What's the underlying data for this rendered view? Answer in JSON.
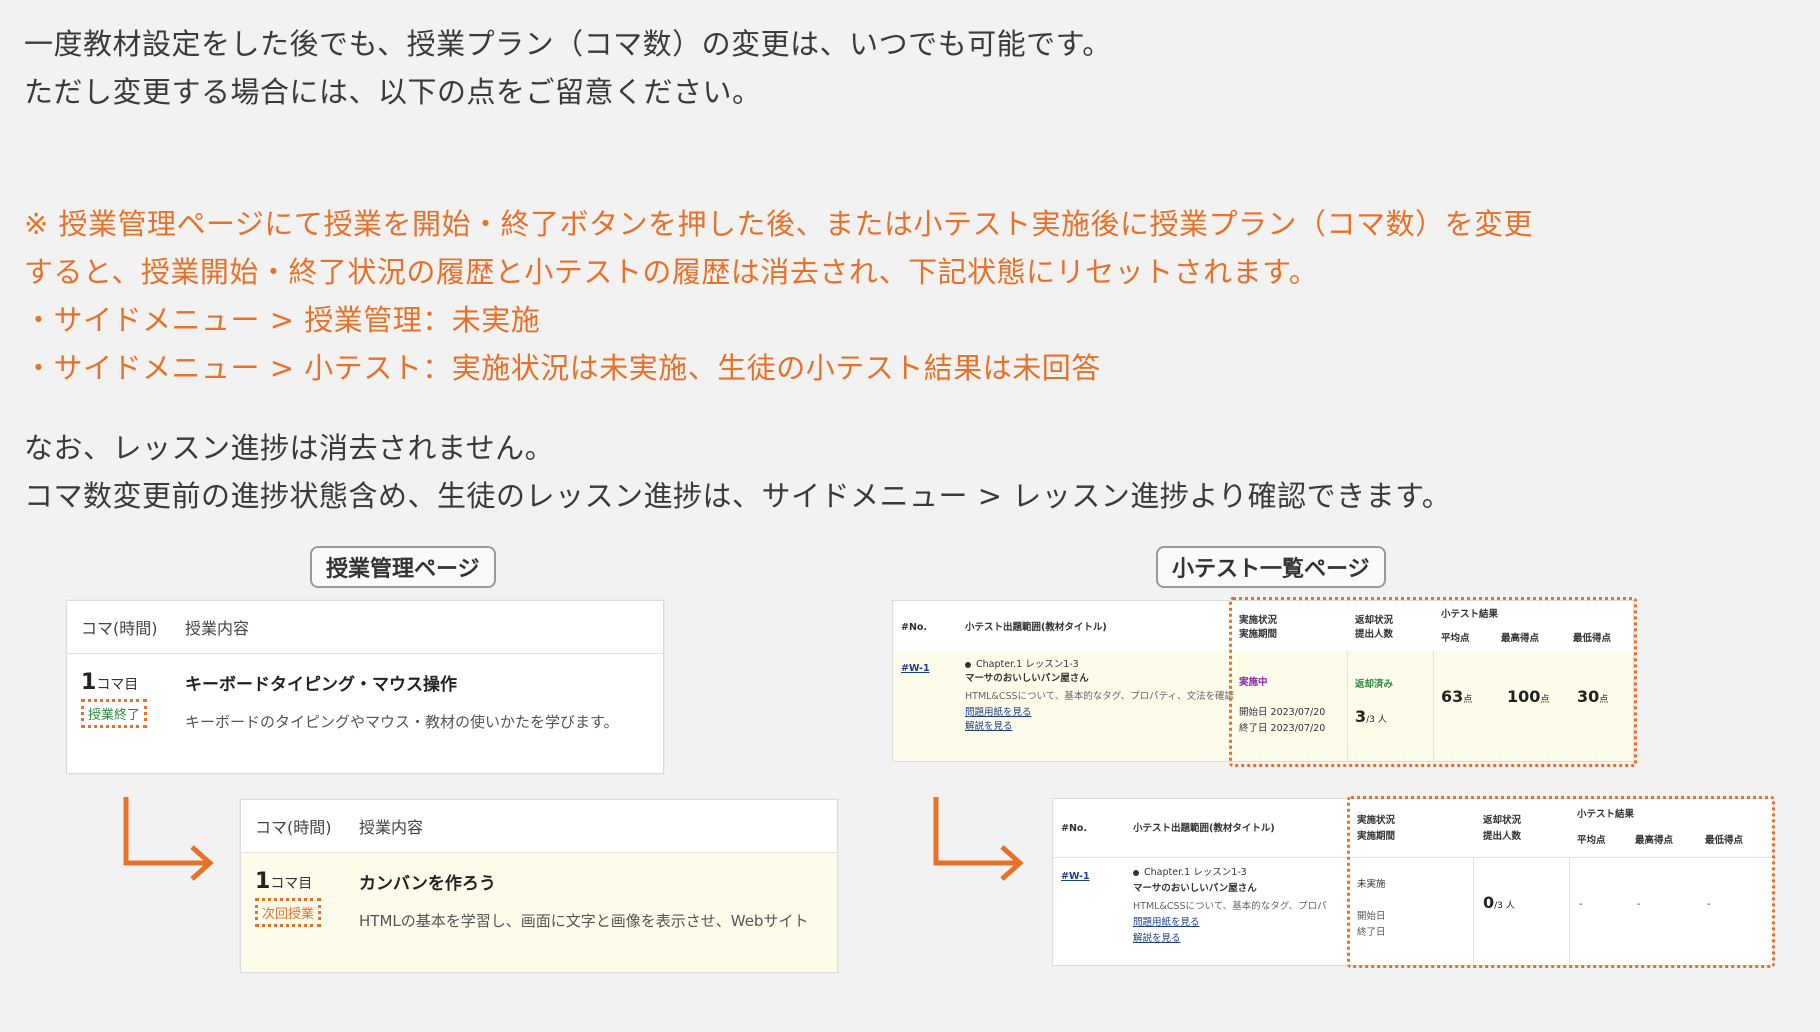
{
  "intro": {
    "line1": "一度教材設定をした後でも、授業プラン（コマ数）の変更は、いつでも可能です。",
    "line2": "ただし変更する場合には、以下の点をご留意ください。"
  },
  "warning": {
    "line1": "※ 授業管理ページにて授業を開始・終了ボタンを押した後、または小テスト実施後に授業プラン（コマ数）を変更",
    "line2": "すると、授業開始・終了状況の履歴と小テストの履歴は消去され、下記状態にリセットされます。",
    "line3": "・サイドメニュー > 授業管理：未実施",
    "line4": "・サイドメニュー > 小テスト：実施状況は未実施、生徒の小テスト結果は未回答"
  },
  "note": {
    "line1": "なお、レッスン進捗は消去されません。",
    "line2": "コマ数変更前の進捗状態含め、生徒のレッスン進捗は、サイドメニュー > レッスン進捗より確認できます。"
  },
  "lesson_page": {
    "caption": "授業管理ページ",
    "col_koma": "コマ(時間)",
    "col_content": "授業内容",
    "before": {
      "koma_num": "1",
      "koma_unit": "コマ目",
      "badge": "授業終了",
      "title": "キーボードタイピング・マウス操作",
      "desc": "キーボードのタイピングやマウス・教材の使いかたを学びます。"
    },
    "after": {
      "koma_num": "1",
      "koma_unit": "コマ目",
      "badge": "次回授業",
      "title": "カンバンを作ろう",
      "desc": "HTMLの基本を学習し、画面に文字と画像を表示させ、Webサイト"
    }
  },
  "quiz_page": {
    "caption": "小テスト一覧ページ",
    "h_no": "#No.",
    "h_range": "小テスト出題範囲(教材タイトル)",
    "h_status1": "実施状況",
    "h_status2": "実施期間",
    "h_return1": "返却状況",
    "h_return2": "提出人数",
    "h_results": "小テスト結果",
    "h_avg": "平均点",
    "h_max": "最高得点",
    "h_min": "最低得点",
    "row_no": "#W-1",
    "chapter": "Chapter.1 レッスン1-3",
    "quiz_title": "マーサのおいしいパン屋さん",
    "before_desc": "HTML&CSSについて、基本的なタグ、プロパティ、文法を確認",
    "after_desc": "HTML&CSSについて、基本的なタグ、プロパ",
    "link_sheet": "問題用紙を見る",
    "link_answer": "解説を見る",
    "start_label": "開始日",
    "end_label": "終了日",
    "before": {
      "status": "実施中",
      "start": "2023/07/20",
      "end": "2023/07/20",
      "return_status": "返却済み",
      "submitted": "3",
      "submitted_total": "/3 人",
      "avg": "63",
      "max": "100",
      "min": "30",
      "pt": "点"
    },
    "after": {
      "status": "未実施",
      "submitted": "0",
      "submitted_total": "/3 人",
      "avg": "-",
      "max": "-",
      "min": "-"
    }
  },
  "colors": {
    "accent_orange": "#e8712a",
    "done_green": "#2e8b3e",
    "active_purple": "#8a1fb5",
    "link_blue": "#1a3e8c",
    "highlight_bg": "#fdfbea"
  }
}
